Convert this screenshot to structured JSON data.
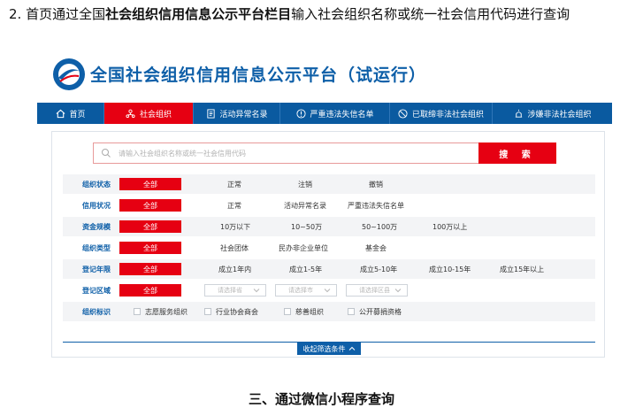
{
  "instruction": {
    "prefix": "2.  首页通过全国",
    "bold": "社会组织信用信息公示平台栏目",
    "suffix": "输入社会组织名称或统一社会信用代码进行查询"
  },
  "site": {
    "title": "全国社会组织信用信息公示平台（试运行）"
  },
  "nav": [
    {
      "label": "首页",
      "icon": "home-icon"
    },
    {
      "label": "社会组织",
      "icon": "org-icon",
      "active": true
    },
    {
      "label": "活动异常名录",
      "icon": "document-icon"
    },
    {
      "label": "严重违法失信名单",
      "icon": "alert-icon"
    },
    {
      "label": "已取缔非法社会组织",
      "icon": "ban-icon"
    },
    {
      "label": "涉嫌非法社会组织",
      "icon": "warning-icon"
    }
  ],
  "search": {
    "placeholder": "请输入社会组织名称或统一社会信用代码",
    "button": "搜 索"
  },
  "filters": {
    "org_status": {
      "label": "组织状态",
      "all": "全部",
      "options": [
        "正常",
        "注销",
        "撤销"
      ]
    },
    "credit_status": {
      "label": "信用状况",
      "all": "全部",
      "options": [
        "正常",
        "活动异常名录",
        "严重违法失信名单"
      ]
    },
    "capital_scale": {
      "label": "资金规模",
      "all": "全部",
      "options": [
        "10万以下",
        "10~50万",
        "50~100万",
        "100万以上"
      ]
    },
    "org_type": {
      "label": "组织类型",
      "all": "全部",
      "options": [
        "社会团体",
        "民办非企业单位",
        "基金会"
      ]
    },
    "reg_years": {
      "label": "登记年限",
      "all": "全部",
      "options": [
        "成立1年内",
        "成立1-5年",
        "成立5-10年",
        "成立10-15年",
        "成立15年以上"
      ]
    },
    "reg_area": {
      "label": "登记区域",
      "all": "全部",
      "selects": [
        "请选择省",
        "请选择市",
        "请选择区县"
      ]
    },
    "org_marks": {
      "label": "组织标识",
      "options": [
        "志愿服务组织",
        "行业协会商会",
        "慈善组织",
        "公开募捐资格"
      ]
    }
  },
  "collapse_label": "收起筛选条件",
  "section_heading": "三、通过微信小程序查询",
  "colors": {
    "brand_blue": "#0a5aa0",
    "accent_red": "#e60012"
  }
}
